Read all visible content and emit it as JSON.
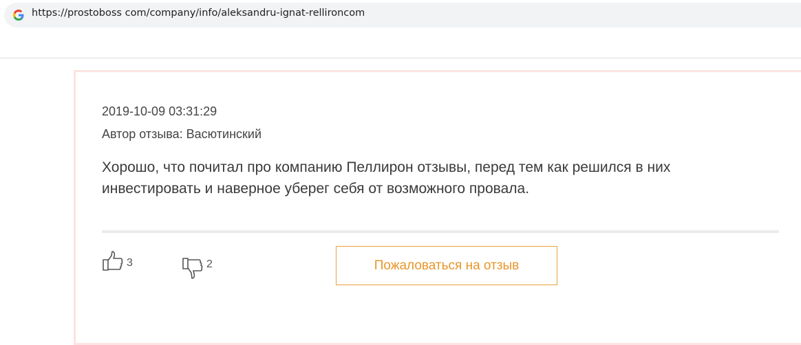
{
  "browser": {
    "url": "https://prostoboss com/company/info/aleksandru-ignat-rellironcom",
    "favicon_icon": "google-g-icon"
  },
  "review": {
    "date": "2019-10-09 03:31:29",
    "author": "Автор отзыва: Васютинский",
    "text": "Хорошо, что почитал про компанию Пеллирон отзывы, перед тем как решился в них инвестировать и наверное уберег себя от возможного провала.",
    "likes": "3",
    "dislikes": "2",
    "like_icon": "thumbs-up-icon",
    "dislike_icon": "thumbs-down-icon",
    "complain_label": "Пожаловаться на отзыв"
  },
  "colors": {
    "card_border": "#fde3e3",
    "accent": "#e8962a",
    "urlbar_bg": "#f1f3f4"
  }
}
